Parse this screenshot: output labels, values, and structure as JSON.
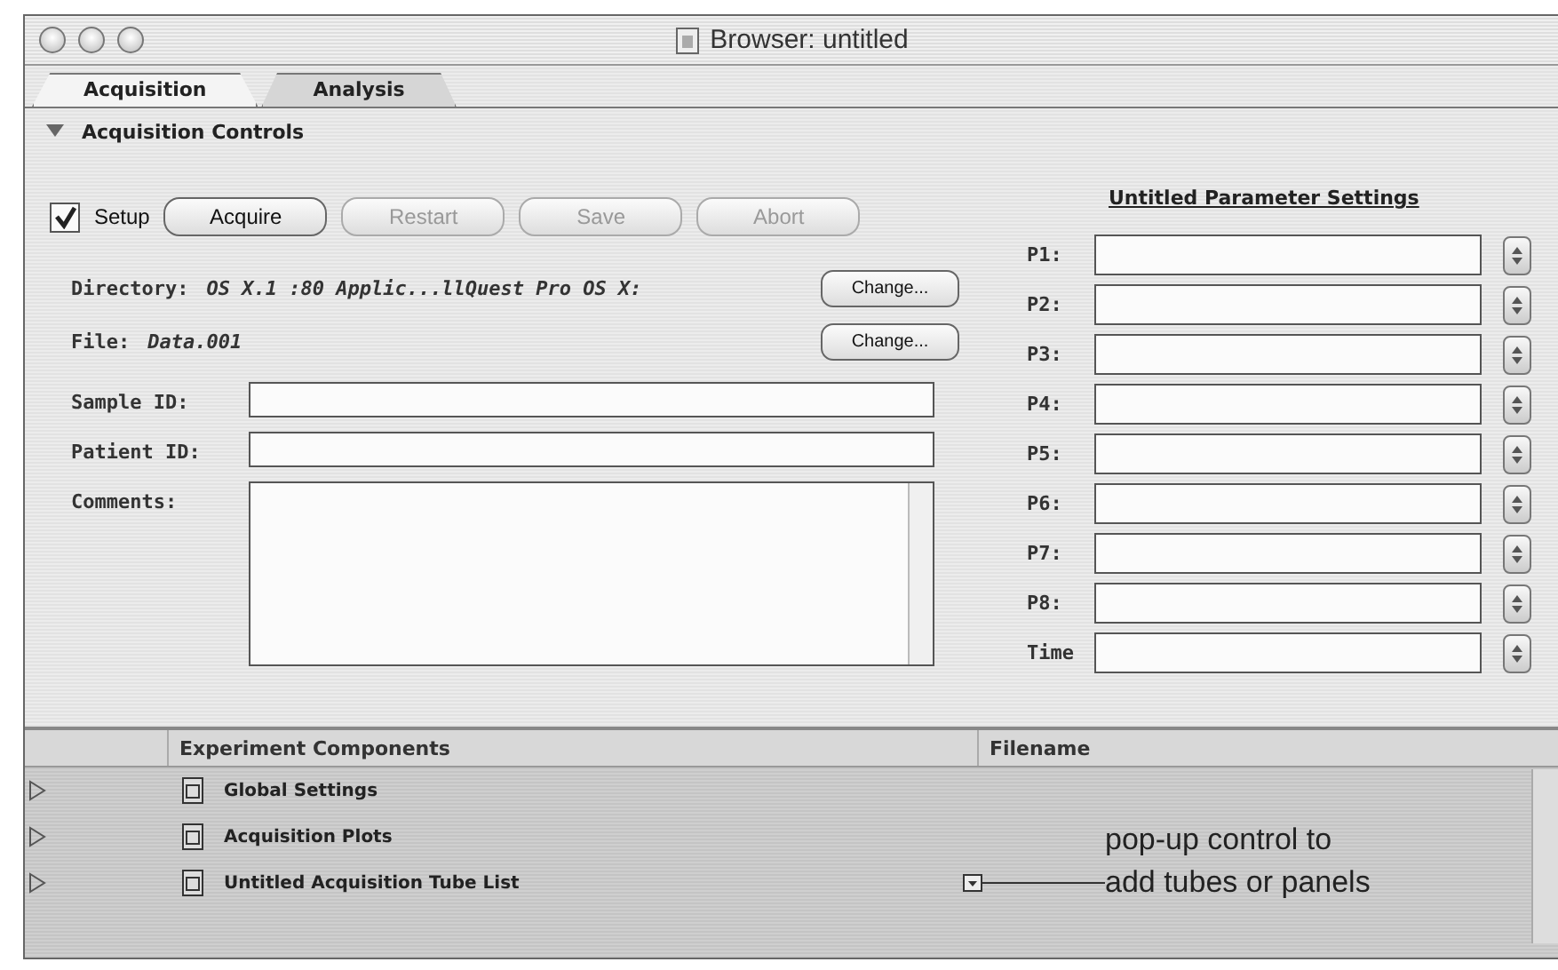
{
  "window": {
    "title": "Browser: untitled"
  },
  "tabs": [
    {
      "label": "Acquisition",
      "selected": true
    },
    {
      "label": "Analysis",
      "selected": false
    }
  ],
  "section": {
    "label": "Acquisition Controls",
    "expanded": true
  },
  "setup": {
    "label": "Setup",
    "checked": true
  },
  "buttons": [
    {
      "label": "Acquire",
      "disabled": false
    },
    {
      "label": "Restart",
      "disabled": true
    },
    {
      "label": "Save",
      "disabled": true
    },
    {
      "label": "Abort",
      "disabled": true
    }
  ],
  "paths": [
    {
      "label": "Directory:",
      "value": "OS X.1 :80 Applic...llQuest Pro OS X:",
      "button": "Change..."
    },
    {
      "label": "File:",
      "value": "Data.001",
      "button": "Change..."
    }
  ],
  "fields": [
    {
      "label": "Sample ID:"
    },
    {
      "label": "Patient ID:"
    }
  ],
  "comments": {
    "label": "Comments:"
  },
  "parameters": {
    "title": "Untitled Parameter Settings",
    "rows": [
      {
        "label": "P1:"
      },
      {
        "label": "P2:"
      },
      {
        "label": "P3:"
      },
      {
        "label": "P4:"
      },
      {
        "label": "P5:"
      },
      {
        "label": "P6:"
      },
      {
        "label": "P7:"
      },
      {
        "label": "P8:"
      },
      {
        "label": "Time"
      }
    ]
  },
  "components": {
    "columns": [
      "Experiment Components",
      "Filename"
    ],
    "rows": [
      {
        "name": "Global Settings",
        "expanded": false
      },
      {
        "name": "Acquisition Plots",
        "expanded": false
      },
      {
        "name": "Untitled Acquisition Tube List",
        "expanded": false
      }
    ]
  },
  "annotation": {
    "lines": [
      "pop-up control to",
      "add tubes or panels"
    ]
  }
}
